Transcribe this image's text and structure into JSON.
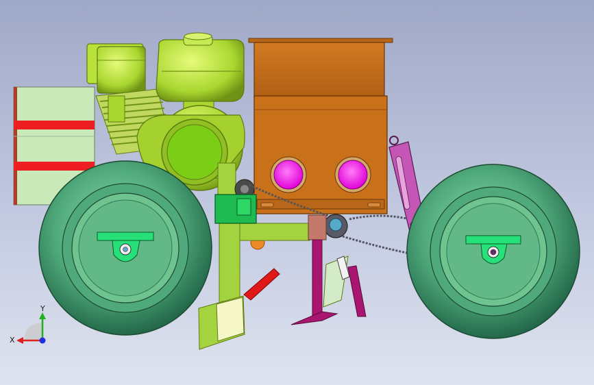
{
  "scene": {
    "colors": {
      "engine": "#b8e23a",
      "engine_dark": "#7e9f1b",
      "engine_light": "#d9f26e",
      "hopper": "#c9701b",
      "hopper_dark": "#8d4a0b",
      "seed_disc": "#ff18f0",
      "wheel_tire": "#5ab384",
      "wheel_tire_dark": "#2d7a53",
      "wheel_hub": "#6fc38f",
      "mount_plate": "#22d36a",
      "frame": "#a3d43f",
      "tank": "#c9e9b8",
      "tank_strap": "#ee1f23",
      "opener": "#a8166f",
      "bracket_pink": "#c457b6",
      "coulter_red": "#e01818",
      "gearbox": "#1dbb52",
      "sprocket_orange": "#f08a28",
      "axis_x": "#e02020",
      "axis_y": "#20b020",
      "axis_z": "#2030e0"
    }
  },
  "triad": {
    "x_label": "X",
    "y_label": "Y"
  }
}
